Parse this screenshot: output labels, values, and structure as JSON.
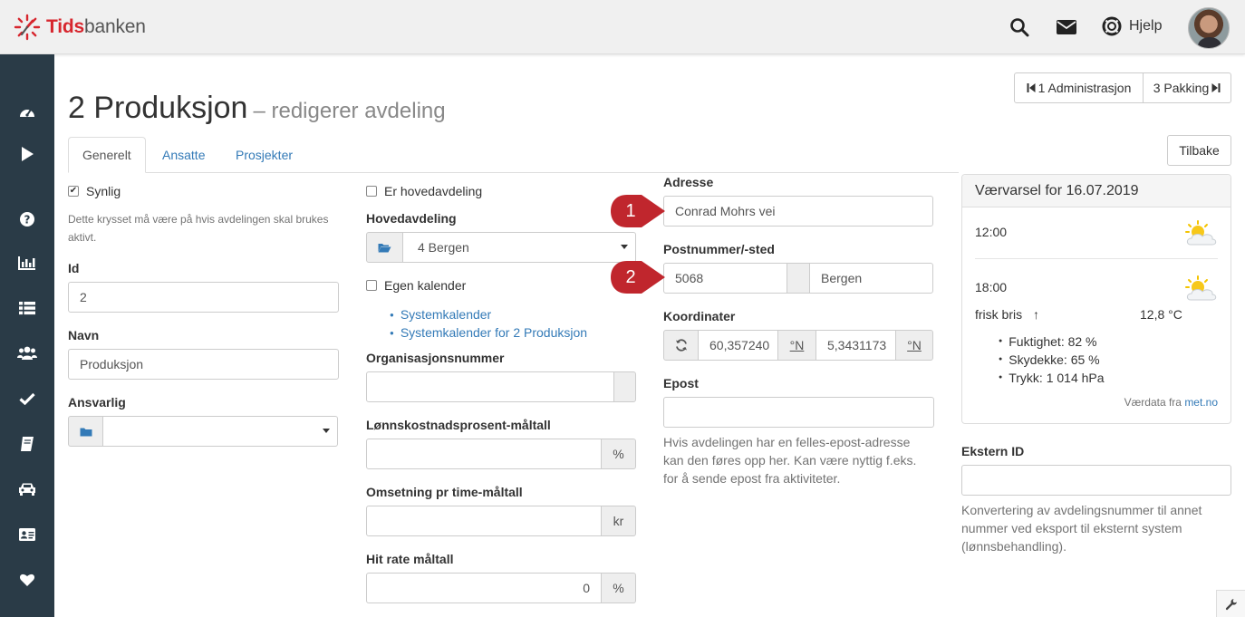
{
  "header": {
    "logo_primary": "Tids",
    "logo_secondary": "banken",
    "help_label": "Hjelp"
  },
  "page": {
    "title": "2 Produksjon",
    "subtitle": "– redigerer avdeling",
    "prev_label": "1 Administrasjon",
    "next_label": "3 Pakking",
    "back_label": "Tilbake"
  },
  "tabs": [
    {
      "label": "Generelt"
    },
    {
      "label": "Ansatte"
    },
    {
      "label": "Prosjekter"
    }
  ],
  "col1": {
    "visible_label": "Synlig",
    "visible_help": "Dette krysset må være på hvis avdelingen skal brukes aktivt.",
    "id_label": "Id",
    "id_value": "2",
    "name_label": "Navn",
    "name_value": "Produksjon",
    "responsible_label": "Ansvarlig",
    "responsible_value": ""
  },
  "col2": {
    "main_dept_check_label": "Er hovedavdeling",
    "main_dept_label": "Hovedavdeling",
    "main_dept_value": "4 Bergen",
    "own_calendar_label": "Egen kalender",
    "calendar_links": [
      "Systemkalender",
      "Systemkalender for 2 Produksjon"
    ],
    "org_number_label": "Organisasjonsnummer",
    "org_number_value": "",
    "salary_target_label": "Lønnskostnadsprosent-måltall",
    "salary_target_unit": "%",
    "revenue_target_label": "Omsetning pr time-måltall",
    "revenue_target_unit": "kr",
    "hit_rate_label": "Hit rate måltall",
    "hit_rate_value": "0",
    "hit_rate_unit": "%"
  },
  "col3": {
    "address_label": "Adresse",
    "address_value": "Conrad Mohrs vei",
    "postal_label": "Postnummer/-sted",
    "postal_code": "5068",
    "postal_place": "Bergen",
    "coords_label": "Koordinater",
    "lat_value": "60,357240",
    "lat_unit": "°N",
    "lon_value": "5,3431173",
    "lon_unit": "°N",
    "email_label": "Epost",
    "email_value": "",
    "email_help": "Hvis avdelingen har en felles-epost-adresse kan den føres opp her. Kan være nyttig f.eks. for å sende epost fra aktiviteter."
  },
  "weather": {
    "title": "Værvarsel for 16.07.2019",
    "slot1_time": "12:00",
    "slot2_time": "18:00",
    "wind": "frisk bris",
    "wind_arrow": "↑",
    "temperature": "12,8 °C",
    "details": [
      "Fuktighet: 82 %",
      "Skydekke: 65 %",
      "Trykk: 1 014 hPa"
    ],
    "source_prefix": "Værdata fra ",
    "source_link": "met.no"
  },
  "col4": {
    "external_id_label": "Ekstern ID",
    "external_id_value": "",
    "external_id_help": "Konvertering av avdelingsnummer til annet nummer ved eksport til eksternt system (lønnsbehandling)."
  },
  "markers": [
    {
      "number": "1"
    },
    {
      "number": "2"
    }
  ],
  "colors": {
    "sidebar": "#2a3b47",
    "link": "#337ab7",
    "brand_red": "#d7262e",
    "marker": "#c0262d"
  }
}
